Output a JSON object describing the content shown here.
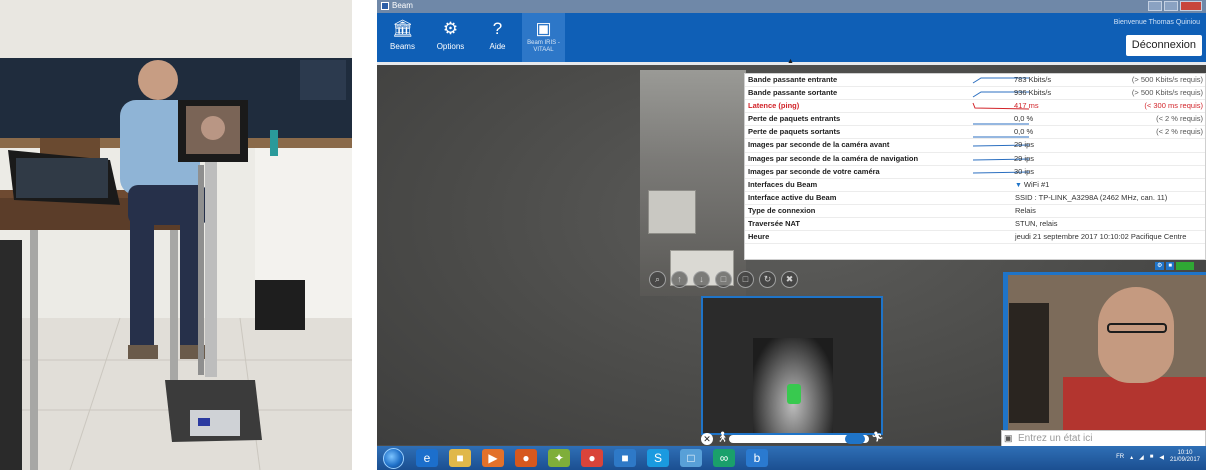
{
  "screen": {
    "window_title": "Beam",
    "nav": [
      {
        "label": "Beams",
        "icon": "building-icon"
      },
      {
        "label": "Options",
        "icon": "gear-icon"
      },
      {
        "label": "Aide",
        "icon": "help-icon"
      },
      {
        "label": "Beam IRIS - VITAAL",
        "icon": "beam-robot-icon"
      }
    ],
    "welcome": "Bienvenue Thomas Quiniou",
    "logout_label": "Déconnexion",
    "stats": [
      {
        "label": "Bande passante entrante",
        "value": "783 Kbits/s",
        "requirement": "(> 500 Kbits/s requis)",
        "alert": false
      },
      {
        "label": "Bande passante sortante",
        "value": "936 Kbits/s",
        "requirement": "(> 500 Kbits/s requis)",
        "alert": false
      },
      {
        "label": "Latence (ping)",
        "value": "417 ms",
        "requirement": "(< 300 ms requis)",
        "alert": true
      },
      {
        "label": "Perte de paquets entrants",
        "value": "0,0 %",
        "requirement": "(< 2 % requis)",
        "alert": false
      },
      {
        "label": "Perte de paquets sortants",
        "value": "0,0 %",
        "requirement": "(< 2 % requis)",
        "alert": false
      },
      {
        "label": "Images par seconde de la caméra avant",
        "value": "29 ips",
        "requirement": "",
        "alert": false
      },
      {
        "label": "Images par seconde de la caméra de navigation",
        "value": "29 ips",
        "requirement": "",
        "alert": false
      },
      {
        "label": "Images par seconde de votre caméra",
        "value": "30 ips",
        "requirement": "",
        "alert": false
      },
      {
        "label": "Interfaces du Beam",
        "value": "WiFi #1",
        "requirement": "",
        "alert": false
      },
      {
        "label": "Interface active du Beam",
        "value": "SSID : TP-LINK_A3298A (2462 MHz, can. 11)",
        "requirement": "",
        "alert": false
      },
      {
        "label": "Type de connexion",
        "value": "Relais",
        "requirement": "",
        "alert": false
      },
      {
        "label": "Traversée NAT",
        "value": "STUN, relais",
        "requirement": "",
        "alert": false
      },
      {
        "label": "Heure",
        "value": "jeudi 21 septembre 2017 10:10:02 Pacifique Centre",
        "requirement": "",
        "alert": false
      }
    ],
    "state_placeholder": "Entrez un état ici",
    "tray": {
      "lang": "FR",
      "time": "10:10",
      "date": "21/09/2017"
    },
    "colors": {
      "accent": "#0f5fb6",
      "alert": "#d2242a",
      "tray_battery": "#2fa834"
    }
  }
}
